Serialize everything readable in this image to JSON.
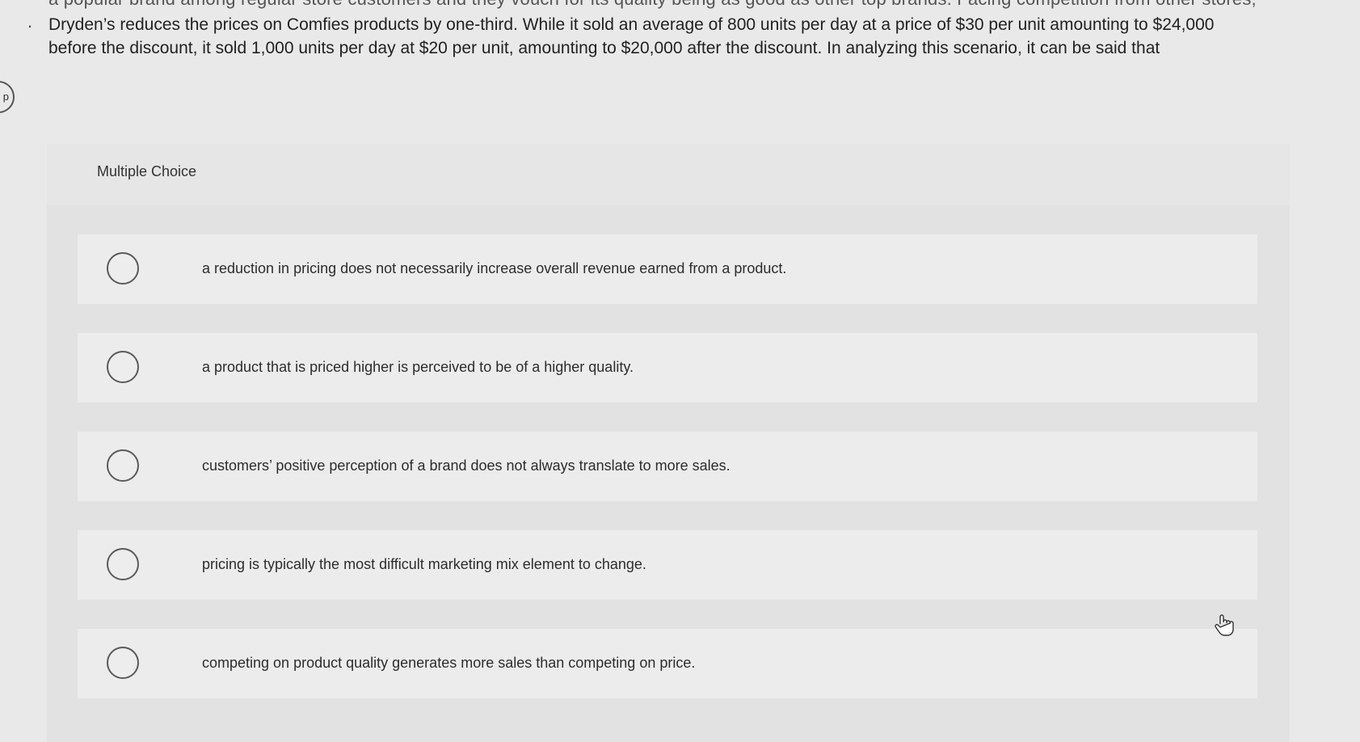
{
  "question": {
    "clipped_previous_line": "a popular brand among regular store customers and they vouch for its quality being as good as other top brands. Facing competition from other stores,",
    "bullet": ".",
    "text": "Dryden’s reduces the prices on Comfies products by one-third. While it sold an average of 800 units per day at a price of $30 per unit amounting to $24,000 before the discount, it sold 1,000 units per day at $20 per unit, amounting to $20,000 after the discount. In analyzing this scenario, it can be said that"
  },
  "side_marker": {
    "glyph": "p"
  },
  "multiple_choice": {
    "title": "Multiple Choice",
    "options": [
      {
        "label": "a reduction in pricing does not necessarily increase overall revenue earned from a product."
      },
      {
        "label": "a product that is priced higher is perceived to be of a higher quality."
      },
      {
        "label": "customers’ positive perception of a brand does not always translate to more sales."
      },
      {
        "label": "pricing is typically the most difficult marketing mix element to change."
      },
      {
        "label": "competing on product quality generates more sales than competing on price."
      }
    ]
  },
  "icons": {
    "cursor": "hand-pointer-icon",
    "option_radio": "radio-unchecked-icon"
  }
}
